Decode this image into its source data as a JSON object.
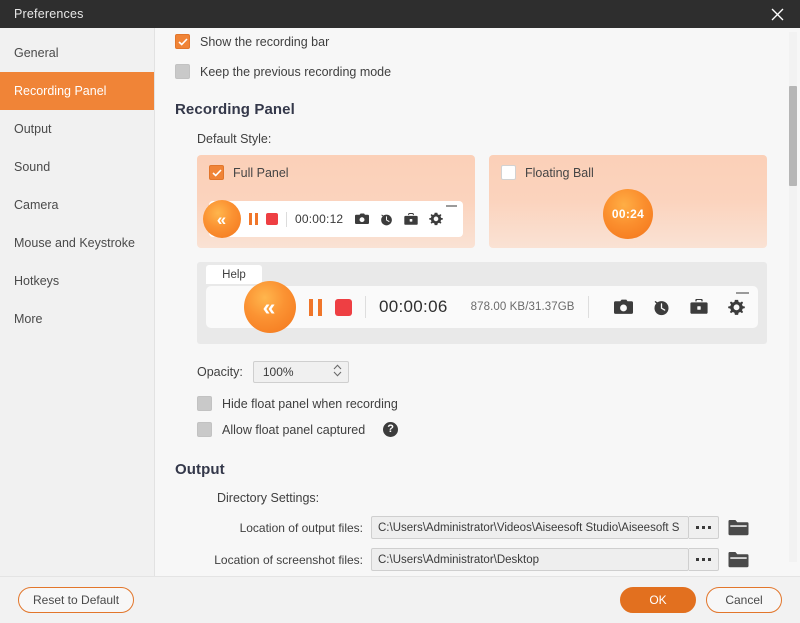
{
  "window": {
    "title": "Preferences",
    "close_icon": "close-icon"
  },
  "sidebar": {
    "items": [
      {
        "label": "General"
      },
      {
        "label": "Recording Panel"
      },
      {
        "label": "Output"
      },
      {
        "label": "Sound"
      },
      {
        "label": "Camera"
      },
      {
        "label": "Mouse and Keystroke"
      },
      {
        "label": "Hotkeys"
      },
      {
        "label": "More"
      }
    ],
    "active_index": 1
  },
  "top_options": [
    {
      "label": "Show the recording bar",
      "checked": true
    },
    {
      "label": "Keep the previous recording mode",
      "checked": false
    }
  ],
  "recording_panel": {
    "heading": "Recording Panel",
    "default_style_label": "Default Style:",
    "full_panel": {
      "label": "Full Panel",
      "checked": true,
      "timer": "00:00:12",
      "collapse_icon": "double-chevron-left-icon",
      "pause_icon": "pause-icon",
      "stop_icon": "stop-icon",
      "icons": [
        "camera-icon",
        "clock-icon",
        "toolbox-icon",
        "gear-icon"
      ],
      "minimize_icon": "minimize-icon"
    },
    "floating_ball": {
      "label": "Floating Ball",
      "checked": false,
      "timer": "00:24"
    },
    "preview": {
      "help_tab": "Help",
      "timer": "00:00:06",
      "size_info": "878.00 KB/31.37GB",
      "collapse_icon": "double-chevron-left-icon",
      "pause_icon": "pause-icon",
      "stop_icon": "stop-icon",
      "icons": [
        "camera-icon",
        "clock-icon",
        "toolbox-icon",
        "gear-icon"
      ],
      "minimize_icon": "minimize-icon"
    },
    "opacity": {
      "label": "Opacity:",
      "value": "100%"
    },
    "options": [
      {
        "label": "Hide float panel when recording",
        "checked": false
      },
      {
        "label": "Allow float panel captured",
        "checked": false,
        "help": "?"
      }
    ]
  },
  "output": {
    "heading": "Output",
    "directory_label": "Directory Settings:",
    "rows": [
      {
        "label": "Location of output files:",
        "value": "C:\\Users\\Administrator\\Videos\\Aiseesoft Studio\\Aiseesoft S",
        "browse": "...",
        "folder_icon": "folder-icon"
      },
      {
        "label": "Location of screenshot files:",
        "value": "C:\\Users\\Administrator\\Desktop",
        "browse": "...",
        "folder_icon": "folder-icon"
      }
    ]
  },
  "footer": {
    "reset": "Reset to Default",
    "ok": "OK",
    "cancel": "Cancel"
  },
  "colors": {
    "accent": "#f08437",
    "accent_dark": "#e2701f",
    "card_bg": "#fbd0b8",
    "stop_red": "#ee3f43",
    "titlebar": "#2e2e2e"
  }
}
